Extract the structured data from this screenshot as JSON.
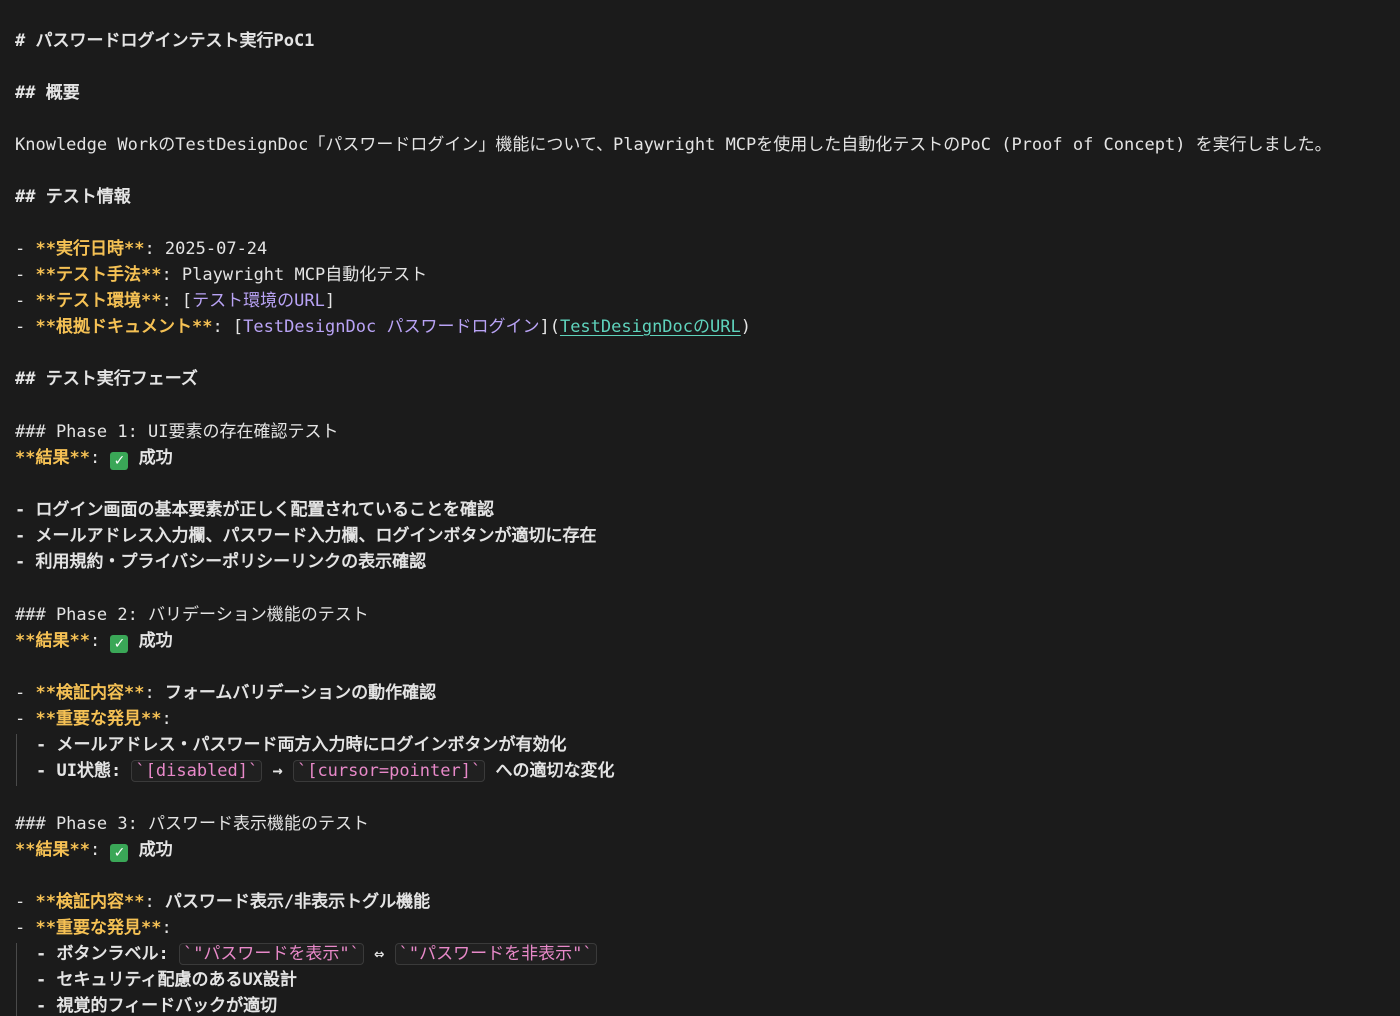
{
  "doc": {
    "title": "# パスワードログインテスト実行PoC1",
    "overview_heading": "## 概要",
    "overview_text": "Knowledge WorkのTestDesignDoc「パスワードログイン」機能について、Playwright MCPを使用した自動化テストのPoC (Proof of Concept) を実行しました。",
    "test_info_heading": "## テスト情報",
    "test_info": {
      "date": {
        "bullet": "- ",
        "label": "**実行日時**",
        "sep": ": ",
        "value": "2025-07-24"
      },
      "method": {
        "bullet": "- ",
        "label": "**テスト手法**",
        "sep": ": ",
        "value": "Playwright MCP自動化テスト"
      },
      "env": {
        "bullet": "- ",
        "label": "**テスト環境**",
        "sep": ": ",
        "open": "[",
        "link": "テスト環境のURL",
        "close": "]"
      },
      "doc": {
        "bullet": "- ",
        "label": "**根拠ドキュメント**",
        "sep": ": ",
        "open": "[",
        "link": "TestDesignDoc パスワードログイン",
        "mid": "](",
        "url": "TestDesignDocのURL",
        "close": ")"
      }
    },
    "phases_heading": "## テスト実行フェーズ",
    "phase1": {
      "heading": "### Phase 1: UI要素の存在確認テスト",
      "result_label": "**結果**",
      "result_sep": ": ",
      "result_icon": "✓",
      "result_value": "成功",
      "items": [
        "- ログイン画面の基本要素が正しく配置されていることを確認",
        "- メールアドレス入力欄、パスワード入力欄、ログインボタンが適切に存在",
        "- 利用規約・プライバシーポリシーリンクの表示確認"
      ]
    },
    "phase2": {
      "heading": "### Phase 2: バリデーション機能のテスト",
      "result_label": "**結果**",
      "result_sep": ": ",
      "result_icon": "✓",
      "result_value": "成功",
      "verify_bullet": "- ",
      "verify_label": "**検証内容**",
      "verify_sep": ": ",
      "verify_value": "フォームバリデーションの動作確認",
      "finding_bullet": "- ",
      "finding_label": "**重要な発見**",
      "finding_sep": ":",
      "sub1": "- メールアドレス・パスワード両方入力時にログインボタンが有効化",
      "sub2_prefix": "- UI状態: ",
      "sub2_code1": "`[disabled]`",
      "sub2_arrow": " → ",
      "sub2_code2": "`[cursor=pointer]`",
      "sub2_suffix": " への適切な変化"
    },
    "phase3": {
      "heading": "### Phase 3: パスワード表示機能のテスト",
      "result_label": "**結果**",
      "result_sep": ": ",
      "result_icon": "✓",
      "result_value": "成功",
      "verify_bullet": "- ",
      "verify_label": "**検証内容**",
      "verify_sep": ": ",
      "verify_value": "パスワード表示/非表示トグル機能",
      "finding_bullet": "- ",
      "finding_label": "**重要な発見**",
      "finding_sep": ":",
      "sub1_prefix": "- ボタンラベル: ",
      "sub1_code1": "`\"パスワードを表示\"`",
      "sub1_arrow": " ⇔ ",
      "sub1_code2": "`\"パスワードを非表示\"`",
      "sub2": "- セキュリティ配慮のあるUX設計",
      "sub3": "- 視覚的フィードバックが適切"
    }
  }
}
